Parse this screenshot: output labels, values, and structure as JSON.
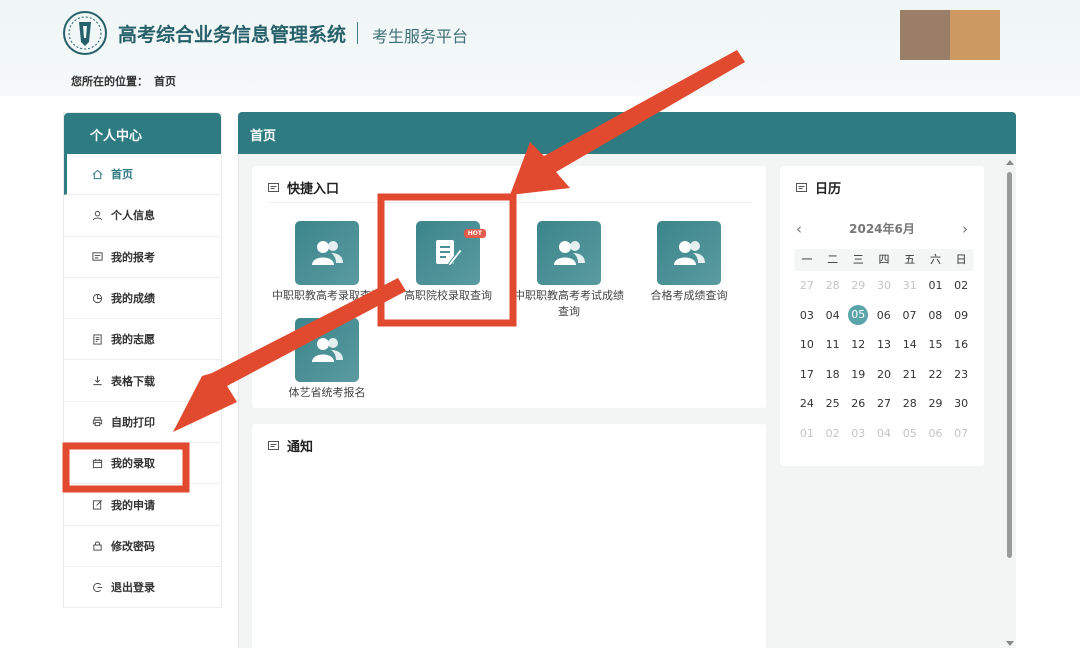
{
  "header": {
    "system_title": "高考综合业务信息管理系统",
    "platform": "考生服务平台"
  },
  "breadcrumb": {
    "label": "您所在的位置：",
    "current": "首页"
  },
  "sidebar": {
    "title": "个人中心",
    "items": [
      {
        "label": "首页",
        "icon": "home-icon"
      },
      {
        "label": "个人信息",
        "icon": "user-icon"
      },
      {
        "label": "我的报考",
        "icon": "register-icon"
      },
      {
        "label": "我的成绩",
        "icon": "pie-chart-icon"
      },
      {
        "label": "我的志愿",
        "icon": "document-icon"
      },
      {
        "label": "表格下载",
        "icon": "download-icon"
      },
      {
        "label": "自助打印",
        "icon": "printer-icon"
      },
      {
        "label": "我的录取",
        "icon": "calendar-icon"
      },
      {
        "label": "我的申请",
        "icon": "edit-icon"
      },
      {
        "label": "修改密码",
        "icon": "lock-icon"
      },
      {
        "label": "退出登录",
        "icon": "logout-icon"
      }
    ]
  },
  "main": {
    "title": "首页",
    "quick_entry": {
      "title": "快捷入口",
      "items": [
        {
          "label": "中职职教高考录取查询",
          "icon": "users-icon"
        },
        {
          "label": "高职院校录取查询",
          "icon": "edit-document-icon",
          "badge": "HOT"
        },
        {
          "label": "中职职教高考考试成绩查询",
          "icon": "users-icon"
        },
        {
          "label": "合格考成绩查询",
          "icon": "users-icon"
        },
        {
          "label": "体艺省统考报名",
          "icon": "users-icon"
        }
      ]
    },
    "notice": {
      "title": "通知"
    },
    "calendar": {
      "title": "日历",
      "month_label": "2024年6月",
      "weekdays": [
        "一",
        "二",
        "三",
        "四",
        "五",
        "六",
        "日"
      ],
      "weeks": [
        [
          "27",
          "28",
          "29",
          "30",
          "31",
          "01",
          "02"
        ],
        [
          "03",
          "04",
          "05",
          "06",
          "07",
          "08",
          "09"
        ],
        [
          "10",
          "11",
          "12",
          "13",
          "14",
          "15",
          "16"
        ],
        [
          "17",
          "18",
          "19",
          "20",
          "21",
          "22",
          "23"
        ],
        [
          "24",
          "25",
          "26",
          "27",
          "28",
          "29",
          "30"
        ],
        [
          "01",
          "02",
          "03",
          "04",
          "05",
          "06",
          "07"
        ]
      ],
      "today": "05"
    }
  },
  "colors": {
    "primary": "#2f7b82",
    "annotation": "#e24a30"
  }
}
